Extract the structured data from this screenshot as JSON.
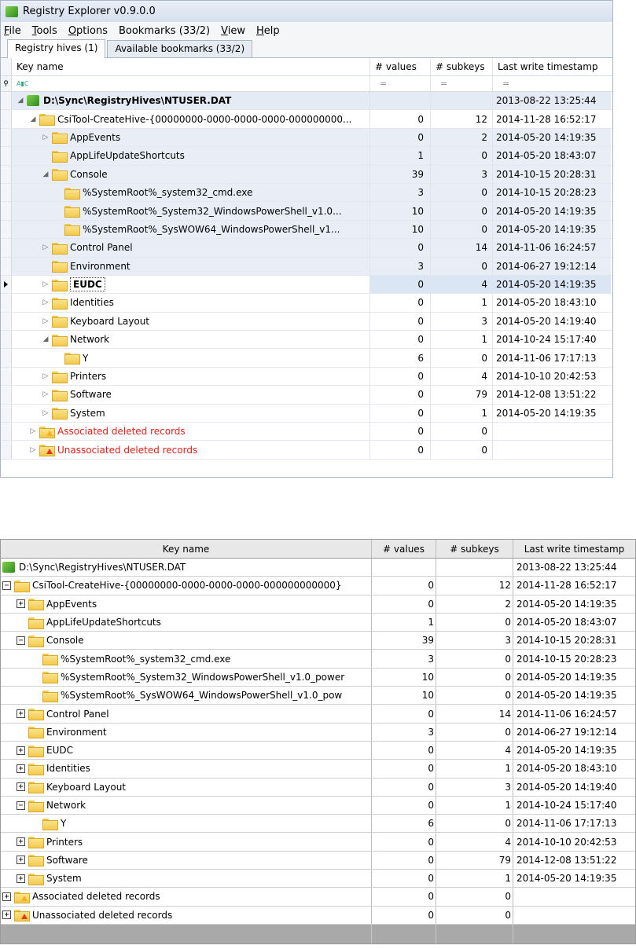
{
  "app": {
    "title": "Registry Explorer v0.9.0.0"
  },
  "menu": [
    "File",
    "Tools",
    "Options",
    "Bookmarks (33/2)",
    "View",
    "Help"
  ],
  "menu_underline": [
    "F",
    "T",
    "O",
    "",
    "V",
    "H"
  ],
  "tabs": [
    "Registry hives (1)",
    "Available bookmarks (33/2)"
  ],
  "columns": {
    "key": "Key name",
    "values": "# values",
    "subkeys": "# subkeys",
    "ts": "Last write timestamp"
  },
  "filter": {
    "key": "",
    "values": "=",
    "subkeys": "=",
    "ts": "="
  },
  "top_rows": [
    {
      "level": 0,
      "exp": "open",
      "icon": "hive",
      "name": "D:\\Sync\\RegistryHives\\NTUSER.DAT",
      "values": "",
      "subkeys": "",
      "ts": "2013-08-22 13:25:44",
      "bold": true
    },
    {
      "level": 1,
      "exp": "open",
      "icon": "folder",
      "name": "CsiTool-CreateHive-{00000000-0000-0000-0000-000000000...",
      "values": "0",
      "subkeys": "12",
      "ts": "2014-11-28 16:52:17"
    },
    {
      "level": 2,
      "exp": "closed",
      "icon": "folder",
      "name": "AppEvents",
      "values": "0",
      "subkeys": "2",
      "ts": "2014-05-20 14:19:35"
    },
    {
      "level": 2,
      "exp": "none",
      "icon": "folder",
      "name": "AppLifeUpdateShortcuts",
      "values": "1",
      "subkeys": "0",
      "ts": "2014-05-20 18:43:07"
    },
    {
      "level": 2,
      "exp": "open",
      "icon": "folder",
      "name": "Console",
      "values": "39",
      "subkeys": "3",
      "ts": "2014-10-15 20:28:31"
    },
    {
      "level": 3,
      "exp": "none",
      "icon": "folder",
      "name": "%SystemRoot%_system32_cmd.exe",
      "values": "3",
      "subkeys": "0",
      "ts": "2014-10-15 20:28:23"
    },
    {
      "level": 3,
      "exp": "none",
      "icon": "folder",
      "name": "%SystemRoot%_System32_WindowsPowerShell_v1.0...",
      "values": "10",
      "subkeys": "0",
      "ts": "2014-05-20 14:19:35"
    },
    {
      "level": 3,
      "exp": "none",
      "icon": "folder",
      "name": "%SystemRoot%_SysWOW64_WindowsPowerShell_v1...",
      "values": "10",
      "subkeys": "0",
      "ts": "2014-05-20 14:19:35"
    },
    {
      "level": 2,
      "exp": "closed",
      "icon": "folder",
      "name": "Control Panel",
      "values": "0",
      "subkeys": "14",
      "ts": "2014-11-06 16:24:57"
    },
    {
      "level": 2,
      "exp": "none",
      "icon": "folder",
      "name": "Environment",
      "values": "3",
      "subkeys": "0",
      "ts": "2014-06-27 19:12:14"
    },
    {
      "level": 2,
      "exp": "closed",
      "icon": "folder",
      "name": "EUDC",
      "values": "0",
      "subkeys": "4",
      "ts": "2014-05-20 14:19:35",
      "bold": true,
      "selected": true
    },
    {
      "level": 2,
      "exp": "closed",
      "icon": "folder",
      "name": "Identities",
      "values": "0",
      "subkeys": "1",
      "ts": "2014-05-20 18:43:10"
    },
    {
      "level": 2,
      "exp": "closed",
      "icon": "folder",
      "name": "Keyboard Layout",
      "values": "0",
      "subkeys": "3",
      "ts": "2014-05-20 14:19:40"
    },
    {
      "level": 2,
      "exp": "open",
      "icon": "folder",
      "name": "Network",
      "values": "0",
      "subkeys": "1",
      "ts": "2014-10-24 15:17:40"
    },
    {
      "level": 3,
      "exp": "none",
      "icon": "folder",
      "name": "Y",
      "values": "6",
      "subkeys": "0",
      "ts": "2014-11-06 17:17:13"
    },
    {
      "level": 2,
      "exp": "closed",
      "icon": "folder",
      "name": "Printers",
      "values": "0",
      "subkeys": "4",
      "ts": "2014-10-10 20:42:53"
    },
    {
      "level": 2,
      "exp": "closed",
      "icon": "folder",
      "name": "Software",
      "values": "0",
      "subkeys": "79",
      "ts": "2014-12-08 13:51:22"
    },
    {
      "level": 2,
      "exp": "closed",
      "icon": "folder",
      "name": "System",
      "values": "0",
      "subkeys": "1",
      "ts": "2014-05-20 14:19:35"
    },
    {
      "level": 1,
      "exp": "closed",
      "icon": "warn-yellow",
      "name": "Associated deleted records",
      "values": "0",
      "subkeys": "0",
      "ts": "",
      "deleted": true
    },
    {
      "level": 1,
      "exp": "closed",
      "icon": "warn-red",
      "name": "Unassociated deleted records",
      "values": "0",
      "subkeys": "0",
      "ts": "",
      "deleted": true
    }
  ],
  "bottom_rows": [
    {
      "level": 0,
      "exp": "none",
      "icon": "hive",
      "name": "D:\\Sync\\RegistryHives\\NTUSER.DAT",
      "values": "",
      "subkeys": "",
      "ts": "2013-08-22 13:25:44"
    },
    {
      "level": 0,
      "exp": "open",
      "icon": "folder",
      "name": "CsiTool-CreateHive-{00000000-0000-0000-0000-000000000000}",
      "values": "0",
      "subkeys": "12",
      "ts": "2014-11-28 16:52:17"
    },
    {
      "level": 1,
      "exp": "closed",
      "icon": "folder",
      "name": "AppEvents",
      "values": "0",
      "subkeys": "2",
      "ts": "2014-05-20 14:19:35"
    },
    {
      "level": 1,
      "exp": "none",
      "icon": "folder",
      "name": "AppLifeUpdateShortcuts",
      "values": "1",
      "subkeys": "0",
      "ts": "2014-05-20 18:43:07"
    },
    {
      "level": 1,
      "exp": "open",
      "icon": "folder",
      "name": "Console",
      "values": "39",
      "subkeys": "3",
      "ts": "2014-10-15 20:28:31"
    },
    {
      "level": 2,
      "exp": "none",
      "icon": "folder",
      "name": "%SystemRoot%_system32_cmd.exe",
      "values": "3",
      "subkeys": "0",
      "ts": "2014-10-15 20:28:23"
    },
    {
      "level": 2,
      "exp": "none",
      "icon": "folder",
      "name": "%SystemRoot%_System32_WindowsPowerShell_v1.0_power",
      "values": "10",
      "subkeys": "0",
      "ts": "2014-05-20 14:19:35"
    },
    {
      "level": 2,
      "exp": "none",
      "icon": "folder",
      "name": "%SystemRoot%_SysWOW64_WindowsPowerShell_v1.0_pow",
      "values": "10",
      "subkeys": "0",
      "ts": "2014-05-20 14:19:35"
    },
    {
      "level": 1,
      "exp": "closed",
      "icon": "folder",
      "name": "Control Panel",
      "values": "0",
      "subkeys": "14",
      "ts": "2014-11-06 16:24:57"
    },
    {
      "level": 1,
      "exp": "none",
      "icon": "folder",
      "name": "Environment",
      "values": "3",
      "subkeys": "0",
      "ts": "2014-06-27 19:12:14"
    },
    {
      "level": 1,
      "exp": "closed",
      "icon": "folder",
      "name": "EUDC",
      "values": "0",
      "subkeys": "4",
      "ts": "2014-05-20 14:19:35"
    },
    {
      "level": 1,
      "exp": "closed",
      "icon": "folder",
      "name": "Identities",
      "values": "0",
      "subkeys": "1",
      "ts": "2014-05-20 18:43:10"
    },
    {
      "level": 1,
      "exp": "closed",
      "icon": "folder",
      "name": "Keyboard Layout",
      "values": "0",
      "subkeys": "3",
      "ts": "2014-05-20 14:19:40"
    },
    {
      "level": 1,
      "exp": "open",
      "icon": "folder",
      "name": "Network",
      "values": "0",
      "subkeys": "1",
      "ts": "2014-10-24 15:17:40"
    },
    {
      "level": 2,
      "exp": "none",
      "icon": "folder",
      "name": "Y",
      "values": "6",
      "subkeys": "0",
      "ts": "2014-11-06 17:17:13"
    },
    {
      "level": 1,
      "exp": "closed",
      "icon": "folder",
      "name": "Printers",
      "values": "0",
      "subkeys": "4",
      "ts": "2014-10-10 20:42:53"
    },
    {
      "level": 1,
      "exp": "closed",
      "icon": "folder",
      "name": "Software",
      "values": "0",
      "subkeys": "79",
      "ts": "2014-12-08 13:51:22"
    },
    {
      "level": 1,
      "exp": "closed",
      "icon": "folder",
      "name": "System",
      "values": "0",
      "subkeys": "1",
      "ts": "2014-05-20 14:19:35"
    },
    {
      "level": 0,
      "exp": "closed",
      "icon": "warn-yellow",
      "name": "Associated deleted records",
      "values": "0",
      "subkeys": "0",
      "ts": ""
    },
    {
      "level": 0,
      "exp": "closed",
      "icon": "warn-red",
      "name": "Unassociated deleted records",
      "values": "0",
      "subkeys": "0",
      "ts": ""
    }
  ],
  "colors": {
    "deleted_text": "#e0201b",
    "selection": "#dbe6f4",
    "folder": "#f3c94a"
  }
}
